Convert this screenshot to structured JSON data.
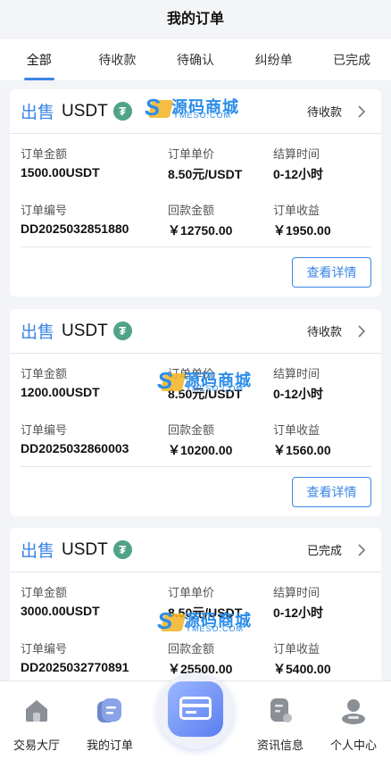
{
  "header": {
    "title": "我的订单"
  },
  "tabs": [
    {
      "label": "全部",
      "active": true
    },
    {
      "label": "待收款",
      "active": false
    },
    {
      "label": "待确认",
      "active": false
    },
    {
      "label": "纠纷单",
      "active": false
    },
    {
      "label": "已完成",
      "active": false
    }
  ],
  "labels": {
    "amount": "订单金额",
    "price": "订单单价",
    "settle": "结算时间",
    "order_no": "订单编号",
    "refund": "回款金额",
    "profit": "订单收益",
    "detail_button": "查看详情"
  },
  "watermark": {
    "brand": "源码商城",
    "domain": "YMESO.COM"
  },
  "orders": [
    {
      "type": "出售",
      "coin": "USDT",
      "status": "待收款",
      "amount": "1500.00USDT",
      "price": "8.50元/USDT",
      "settle": "0-12小时",
      "order_no": "DD2025032851880",
      "refund": "￥12750.00",
      "profit": "￥1950.00"
    },
    {
      "type": "出售",
      "coin": "USDT",
      "status": "待收款",
      "amount": "1200.00USDT",
      "price": "8.50元/USDT",
      "settle": "0-12小时",
      "order_no": "DD2025032860003",
      "refund": "￥10200.00",
      "profit": "￥1560.00"
    },
    {
      "type": "出售",
      "coin": "USDT",
      "status": "已完成",
      "amount": "3000.00USDT",
      "price": "8.50元/USDT",
      "settle": "0-12小时",
      "order_no": "DD2025032770891",
      "refund": "￥25500.00",
      "profit": "￥5400.00"
    }
  ],
  "tabbar": [
    {
      "label": "交易大厅",
      "icon": "home-icon"
    },
    {
      "label": "我的订单",
      "icon": "orders-icon"
    },
    {
      "label": "",
      "icon": "card-icon"
    },
    {
      "label": "资讯信息",
      "icon": "news-icon"
    },
    {
      "label": "个人中心",
      "icon": "user-icon"
    }
  ],
  "colors": {
    "accent": "#3a85e6",
    "tether": "#50a387"
  }
}
